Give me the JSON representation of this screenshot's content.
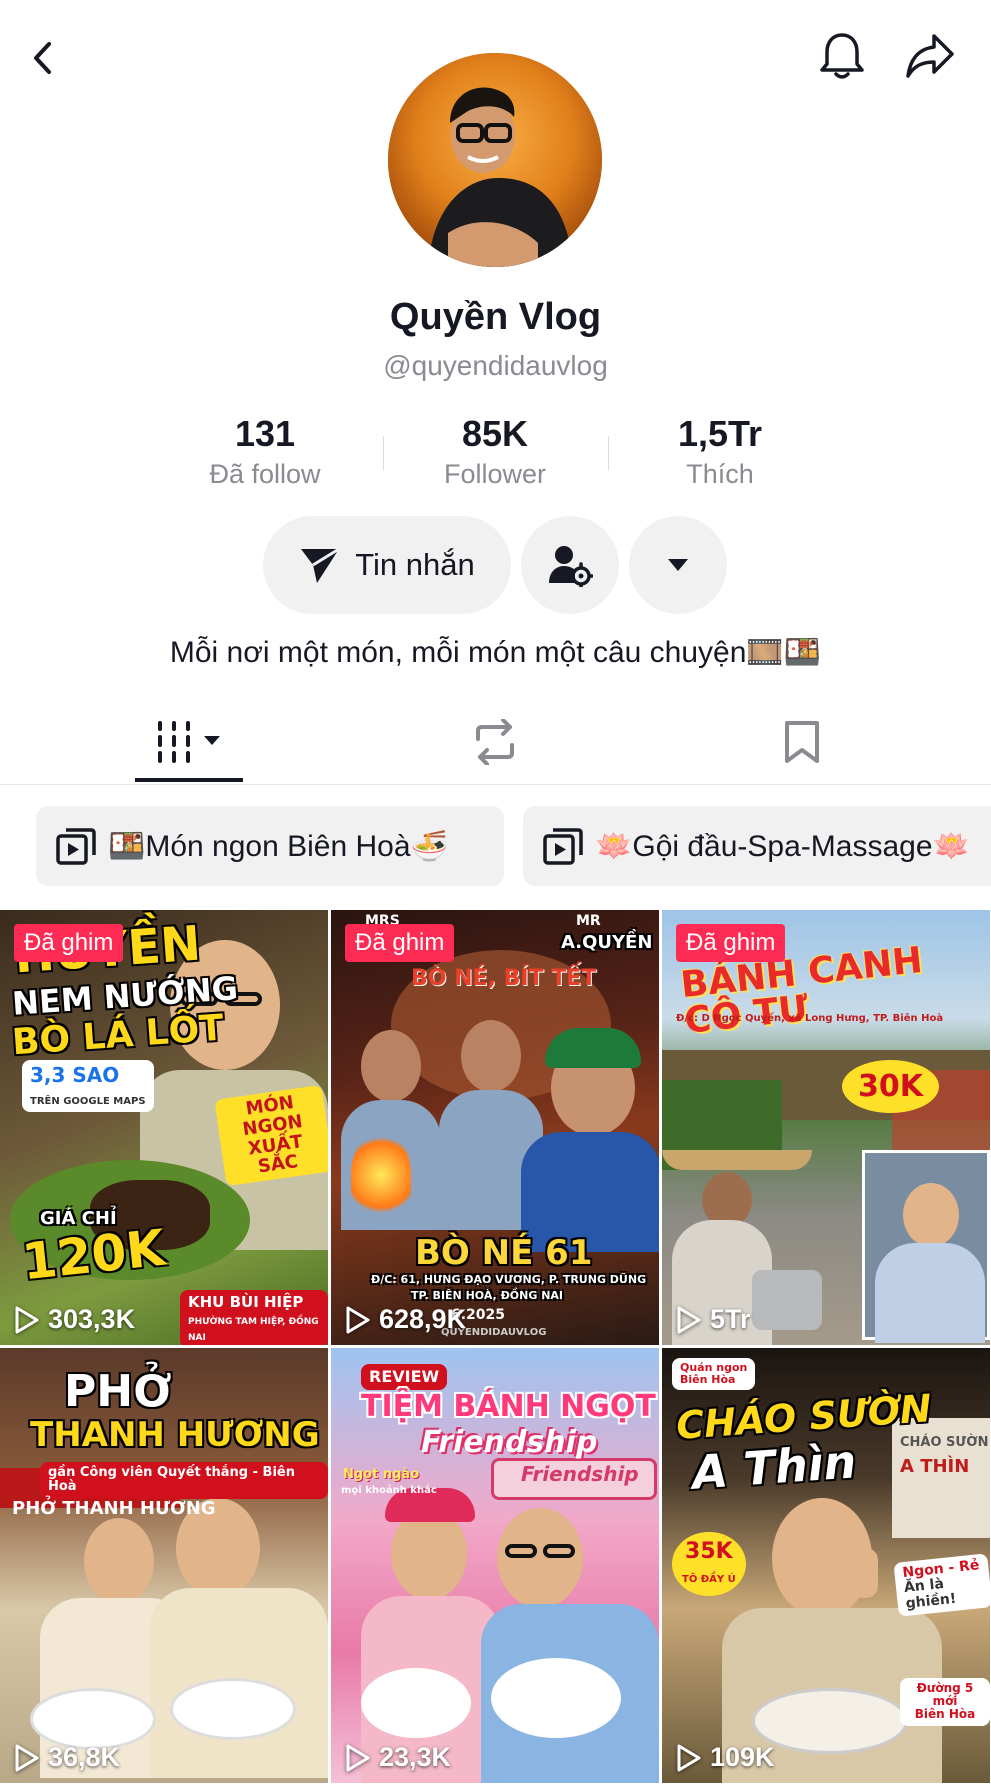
{
  "profile": {
    "name": "Quyền Vlog",
    "handle": "@quyendidauvlog",
    "bio": "Mỗi nơi một món, mỗi món một câu chuyện🎞️🍱"
  },
  "stats": [
    {
      "value": "131",
      "label": "Đã follow"
    },
    {
      "value": "85K",
      "label": "Follower"
    },
    {
      "value": "1,5Tr",
      "label": "Thích"
    }
  ],
  "actions": {
    "message_label": "Tin nhắn"
  },
  "tabs": [
    "videos",
    "reposts",
    "saved"
  ],
  "playlists": [
    {
      "label": "🍱Món ngon Biên Hoà🍜"
    },
    {
      "label": "🪷Gội đầu-Spa-Massage🪷"
    }
  ],
  "videos": [
    {
      "pinned_label": "Đã ghim",
      "views": "303,3K",
      "overlay": [
        "HUYỀN",
        "NEM NƯỚNG",
        "BÒ LÁ LỐT"
      ],
      "stickers": [
        "3,3 SAO",
        "TRÊN GOOGLE MAPS",
        "MÓN NGON",
        "XUẤT SẮC",
        "GIÁ CHỈ",
        "120K",
        "KHU BÙI HIỆP",
        "PHƯỜNG TAM HIỆP, ĐỒNG NAI"
      ]
    },
    {
      "pinned_label": "Đã ghim",
      "views": "628,9K",
      "overlay": [
        "BÒ NÉ, BÍT TẾT",
        "BÒ NÉ 61"
      ],
      "stickers": [
        "MRS",
        "MR",
        "A.QUYỀN",
        "Đ/C: 61, HƯNG ĐẠO VƯƠNG, P. TRUNG DŨNG",
        "TP. BIÊN HOÀ, ĐỒNG NAI",
        "6.2025",
        "QUYENDIDAUVLOG"
      ]
    },
    {
      "pinned_label": "Đã ghim",
      "views": "5Tr",
      "overlay": [
        "BÁNH CANH CÔ TƯ"
      ],
      "stickers": [
        "Đ/c: D Ngọc Quyến, xã Long Hưng, TP. Biên Hoà",
        "30K"
      ]
    },
    {
      "views": "36,8K",
      "overlay": [
        "PHỞ",
        "THANH HƯƠNG"
      ],
      "stickers": [
        "gần Công viên Quyết thắng - Biên Hoà",
        "PHỞ THANH HƯƠNG"
      ]
    },
    {
      "views": "23,3K",
      "overlay": [
        "TIỆM BÁNH NGỌT",
        "Friendship"
      ],
      "stickers": [
        "REVIEW",
        "Ngọt ngào",
        "mọi khoảnh khắc",
        "Friendship"
      ]
    },
    {
      "views": "109K",
      "overlay": [
        "CHÁO SƯỜN",
        "A Thìn"
      ],
      "stickers": [
        "Quán ngon",
        "Biên Hòa",
        "35K",
        "TÔ ĐẦY Ú",
        "Ngon - Rẻ",
        "Ăn là ghiền!",
        "Đường 5 mới",
        "Biên Hòa",
        "CHÁO SƯỜN",
        "A THÌN"
      ]
    }
  ],
  "colors": {
    "accent": "#fe2c55",
    "text": "#161823",
    "muted": "#8a8b91",
    "button_bg": "#f1f1f2"
  },
  "icons": [
    "back-icon",
    "bell-icon",
    "share-icon",
    "send-icon",
    "user-settings-icon",
    "caret-down-icon",
    "grid-icon",
    "repost-icon",
    "bookmark-icon",
    "playlist-icon",
    "play-icon"
  ]
}
